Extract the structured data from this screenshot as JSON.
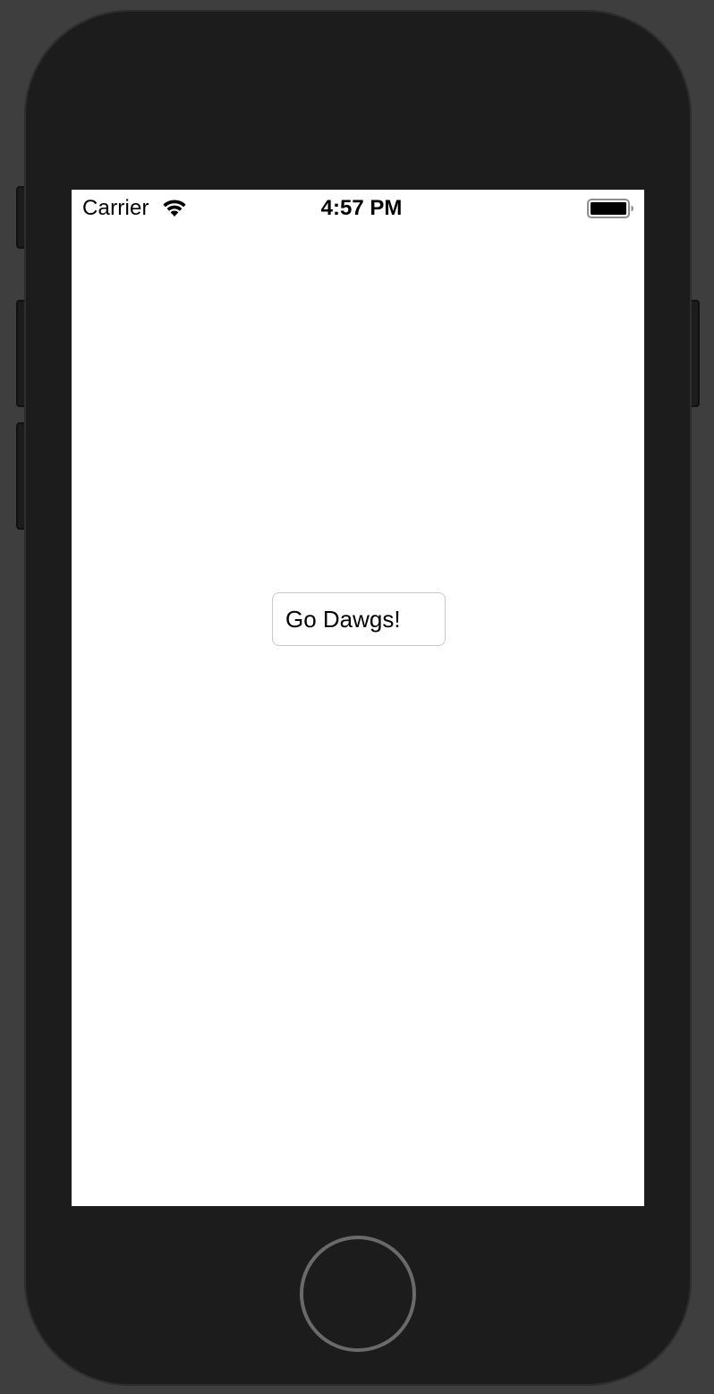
{
  "status_bar": {
    "carrier": "Carrier",
    "time": "4:57 PM",
    "wifi_icon": "wifi-icon",
    "battery_icon": "battery-full-icon"
  },
  "main": {
    "button_label": "Go Dawgs!"
  },
  "device": {
    "home_button": "home-button"
  },
  "colors": {
    "device_body": "#1c1c1c",
    "screen_background": "#ffffff",
    "home_ring": "#6a6a6a",
    "button_border": "#c8c8c8"
  }
}
